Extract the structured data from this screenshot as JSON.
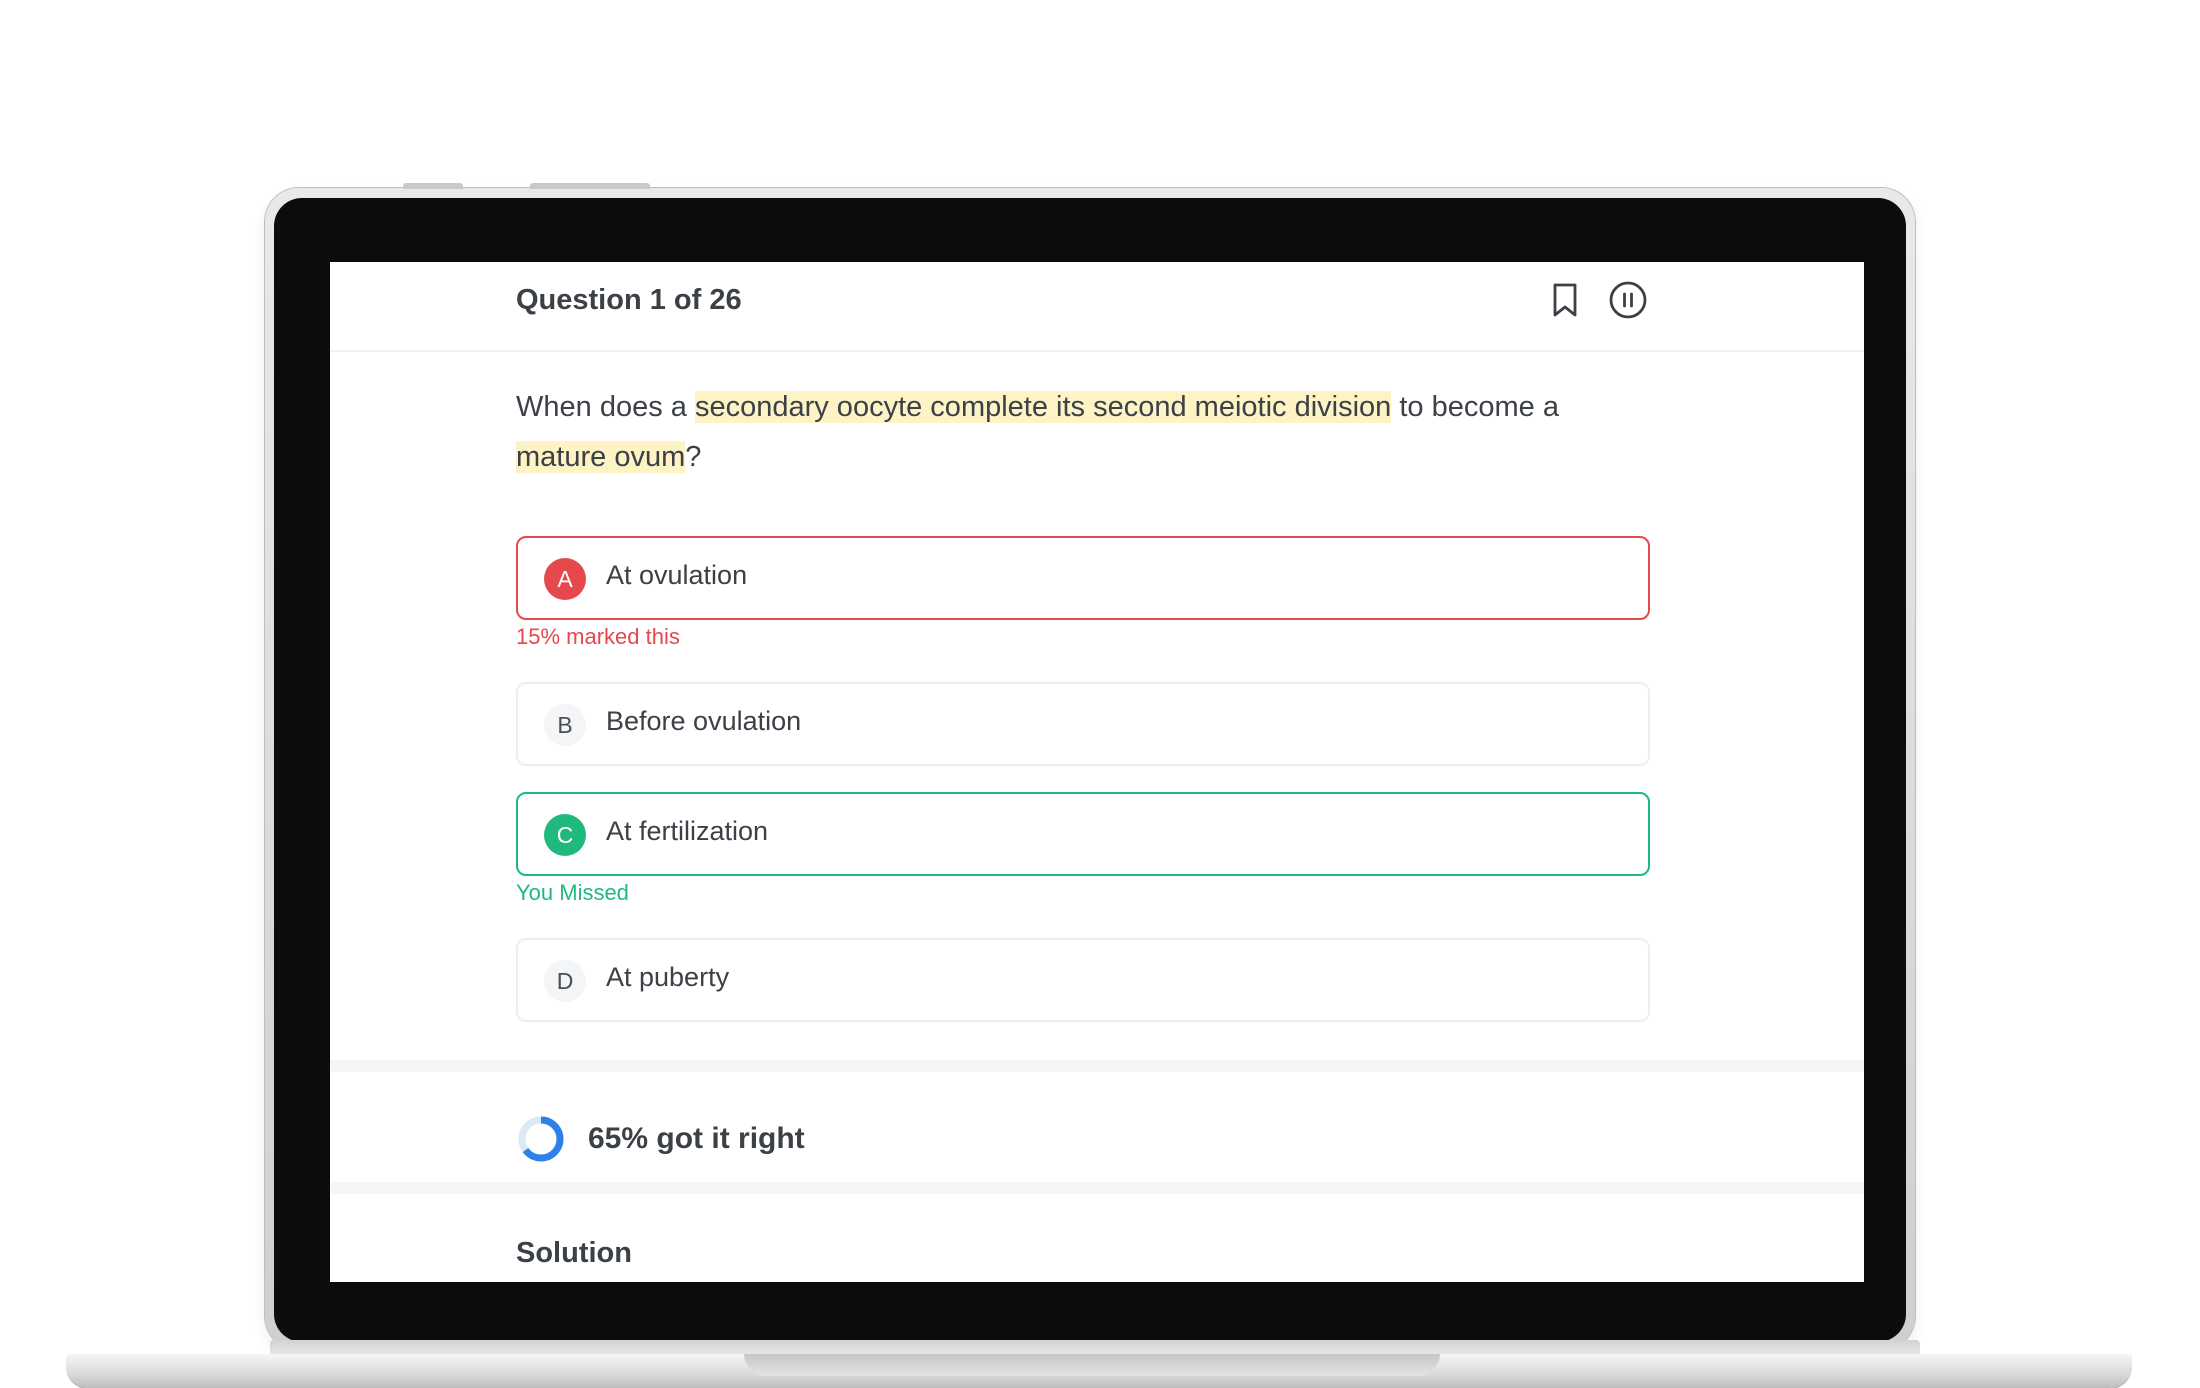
{
  "header": {
    "question_counter": "Question 1 of 26",
    "bookmark_icon": "bookmark-icon",
    "pause_icon": "pause-circle-icon"
  },
  "question": {
    "part1": "When does a ",
    "highlight1": "secondary oocyte complete its second meiotic division",
    "part2": " to become a ",
    "highlight2": "mature ovum",
    "part3": "?"
  },
  "options": [
    {
      "letter": "A",
      "text": "At ovulation",
      "state": "wrong",
      "note": "15% marked this"
    },
    {
      "letter": "B",
      "text": "Before ovulation",
      "state": "neutral",
      "note": ""
    },
    {
      "letter": "C",
      "text": "At fertilization",
      "state": "correct",
      "note": "You Missed"
    },
    {
      "letter": "D",
      "text": "At puberty",
      "state": "neutral",
      "note": ""
    }
  ],
  "stats": {
    "percent_correct": 65,
    "label": "65% got it right"
  },
  "solution": {
    "title": "Solution"
  },
  "colors": {
    "wrong": "#e5484d",
    "correct": "#1fb97e",
    "highlight": "#fdf3c4",
    "ring_fill": "#2f80e8",
    "ring_track": "#dde8f7"
  }
}
